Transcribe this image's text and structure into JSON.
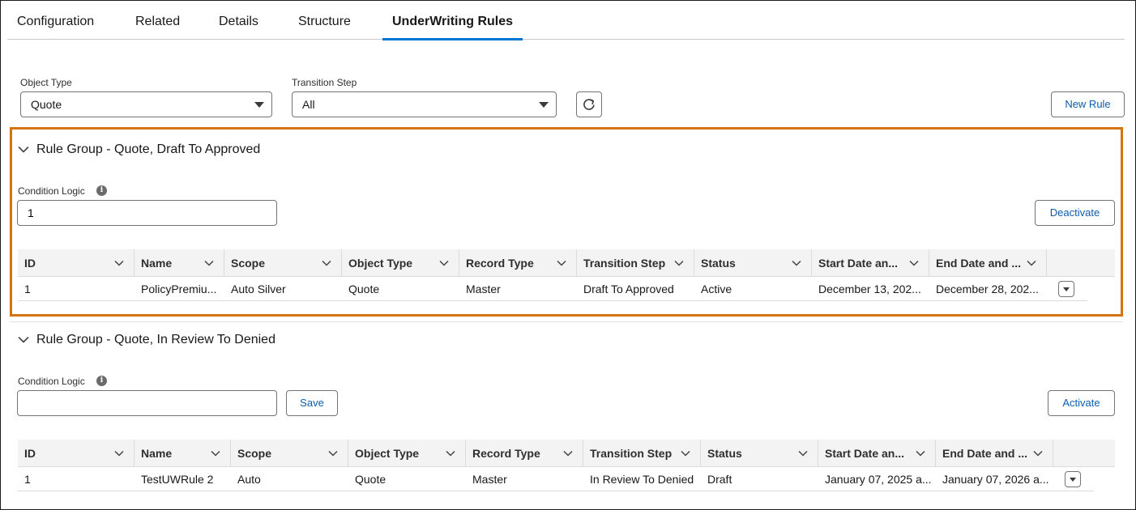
{
  "tabs": [
    {
      "label": "Configuration"
    },
    {
      "label": "Related"
    },
    {
      "label": "Details"
    },
    {
      "label": "Structure"
    },
    {
      "label": "UnderWriting Rules",
      "active": true
    }
  ],
  "filters": {
    "object_type_label": "Object Type",
    "object_type_value": "Quote",
    "transition_step_label": "Transition Step",
    "transition_step_value": "All",
    "new_rule_label": "New Rule"
  },
  "columns": [
    "ID",
    "Name",
    "Scope",
    "Object Type",
    "Record Type",
    "Transition Step",
    "Status",
    "Start Date an...",
    "End Date and ..."
  ],
  "groups": [
    {
      "title": "Rule Group - Quote, Draft To Approved",
      "condition_logic_label": "Condition Logic",
      "condition_logic_value": "1",
      "action_label": "Deactivate",
      "rows": [
        [
          "1",
          "PolicyPremiu...",
          "Auto Silver",
          "Quote",
          "Master",
          "Draft To Approved",
          "Active",
          "December 13, 202...",
          "December 28, 202..."
        ]
      ]
    },
    {
      "title": "Rule Group - Quote, In Review To Denied",
      "condition_logic_label": "Condition Logic",
      "condition_logic_value": "",
      "save_label": "Save",
      "action_label": "Activate",
      "rows": [
        [
          "1",
          "TestUWRule 2",
          "Auto",
          "Quote",
          "Master",
          "In Review To Denied",
          "Draft",
          "January 07, 2025 a...",
          "January 07, 2026 a..."
        ]
      ]
    }
  ],
  "colors": {
    "accent": "#0176d3",
    "highlight": "#d4740c",
    "button_text": "#0b5cab"
  }
}
